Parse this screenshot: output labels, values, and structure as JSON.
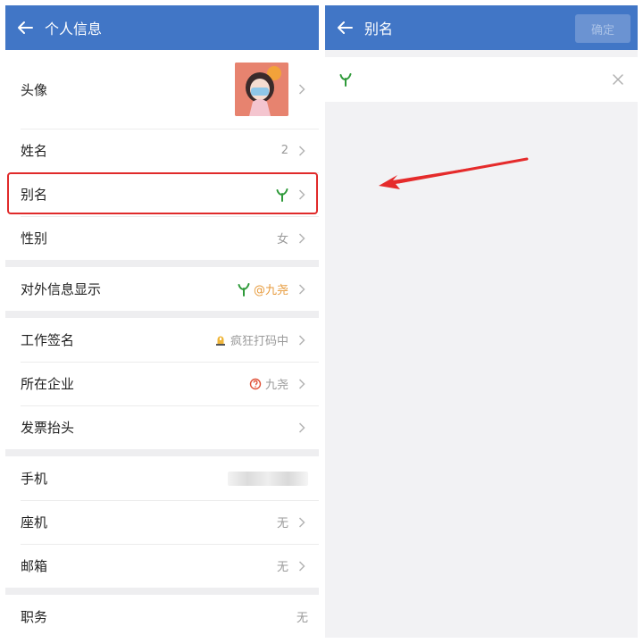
{
  "left": {
    "header_title": "个人信息",
    "rows_group1": [
      {
        "key": "avatar",
        "label": "头像"
      },
      {
        "key": "name",
        "label": "姓名",
        "value": "2"
      },
      {
        "key": "alias",
        "label": "别名",
        "value_icon": "sprout-icon"
      },
      {
        "key": "gender",
        "label": "性别",
        "value": "女"
      }
    ],
    "rows_group2": [
      {
        "key": "external",
        "label": "对外信息显示",
        "value": "@九尧"
      }
    ],
    "rows_group3": [
      {
        "key": "signature",
        "label": "工作签名",
        "value": "疯狂打码中"
      },
      {
        "key": "company",
        "label": "所在企业",
        "value": "九尧"
      },
      {
        "key": "invoice",
        "label": "发票抬头"
      }
    ],
    "rows_group4": [
      {
        "key": "mobile",
        "label": "手机"
      },
      {
        "key": "landline",
        "label": "座机",
        "value": "无"
      },
      {
        "key": "email",
        "label": "邮箱",
        "value": "无"
      }
    ],
    "rows_group5": [
      {
        "key": "position",
        "label": "职务",
        "value": "无"
      }
    ]
  },
  "right": {
    "header_title": "别名",
    "confirm_label": "确定",
    "alias_input_icon": "sprout-icon"
  },
  "colors": {
    "header_blue": "#4176c6",
    "highlight_red": "#e02a2a",
    "sprout_green": "#2f9a3a",
    "orange_text": "#e79a3b"
  }
}
